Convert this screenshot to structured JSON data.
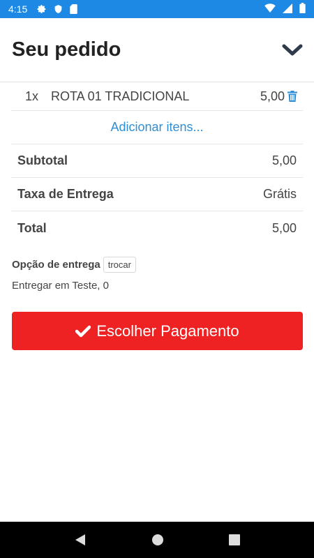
{
  "status_bar": {
    "time": "4:15",
    "icons": [
      "settings-icon",
      "shield-icon",
      "sd-card-icon",
      "wifi-icon",
      "signal-icon",
      "battery-icon"
    ]
  },
  "header": {
    "title": "Seu pedido",
    "collapse_icon": "chevron-down-icon"
  },
  "items": [
    {
      "qty": "1x",
      "name": "ROTA 01 TRADICIONAL",
      "price": "5,00",
      "remove_icon": "trash-icon"
    }
  ],
  "add_items_link": "Adicionar itens...",
  "summary": {
    "subtotal_label": "Subtotal",
    "subtotal_value": "5,00",
    "delivery_fee_label": "Taxa de Entrega",
    "delivery_fee_value": "Grátis",
    "total_label": "Total",
    "total_value": "5,00"
  },
  "delivery": {
    "option_label": "Opção de entrega",
    "change_button": "trocar",
    "address": "Entregar em Teste, 0"
  },
  "pay_button": {
    "label": "Escolher Pagamento",
    "icon": "check-icon"
  },
  "colors": {
    "status_bar": "#1e88e5",
    "accent_link": "#2f8fd6",
    "primary_button": "#ee2222"
  },
  "nav_bar": {
    "buttons": [
      "back-icon",
      "home-icon",
      "recents-icon"
    ]
  }
}
